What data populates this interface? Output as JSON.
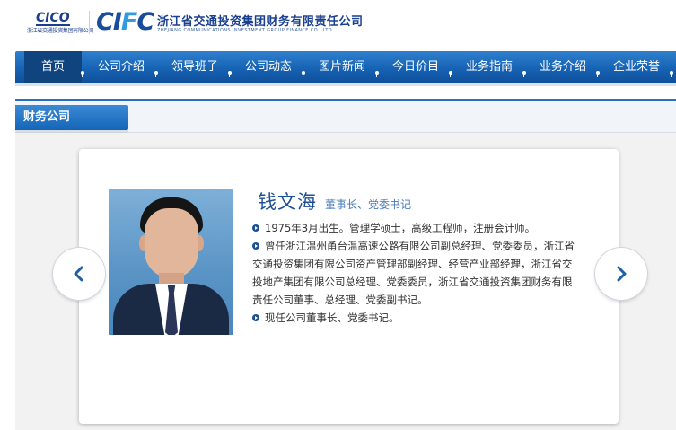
{
  "header": {
    "logo_small_letters": "CICO",
    "logo_small_caption": "浙江省交通投资集团有限公司",
    "logo_letters": [
      "C",
      "I",
      "F",
      "C"
    ],
    "company_name_cn": "浙江省交通投资集团财务有限责任公司",
    "company_name_en": "ZHEJIANG COMMUNICATIONS INVESTMENT GROUP FINANCE CO., LTD"
  },
  "nav": {
    "items": [
      {
        "label": "首页",
        "active": true
      },
      {
        "label": "公司介绍",
        "active": false
      },
      {
        "label": "领导班子",
        "active": false
      },
      {
        "label": "公司动态",
        "active": false
      },
      {
        "label": "图片新闻",
        "active": false
      },
      {
        "label": "今日价目",
        "active": false
      },
      {
        "label": "业务指南",
        "active": false
      },
      {
        "label": "业务介绍",
        "active": false
      },
      {
        "label": "企业荣誉",
        "active": false
      }
    ]
  },
  "section": {
    "tab_label": "财务公司"
  },
  "profile": {
    "name": "钱文海",
    "title": "董事长、党委书记",
    "bio_line1": "1975年3月出生。管理学硕士，高级工程师，注册会计师。",
    "bio_line2": "曾任浙江温州甬台温高速公路有限公司副总经理、党委委员，浙江省交通投资集团有限公司资产管理部副经理、经营产业部经理，浙江省交投地产集团有限公司总经理、党委委员，浙江省交通投资集团财务有限责任公司董事、总经理、党委副书记。",
    "bio_line3": "现任公司董事长、党委书记。"
  },
  "carousel": {
    "prev_icon": "chevron-left-icon",
    "next_icon": "chevron-right-icon"
  },
  "colors": {
    "brand_blue": "#1d4f96",
    "nav_blue": "#1560b0",
    "accent_light_blue": "#2f9be0"
  }
}
